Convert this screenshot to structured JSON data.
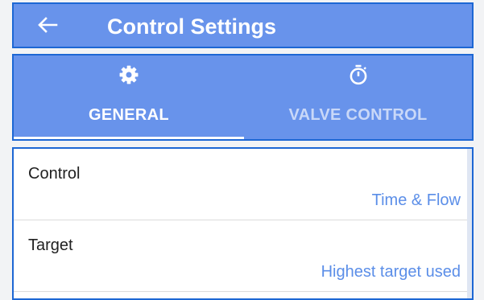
{
  "header": {
    "title": "Control Settings",
    "back_icon": "arrow-left-icon"
  },
  "tabs": [
    {
      "label": "GENERAL",
      "icon": "gear-icon",
      "selected": true
    },
    {
      "label": "VALVE CONTROL",
      "icon": "stopwatch-icon",
      "selected": false
    }
  ],
  "settings": [
    {
      "label": "Control",
      "value": "Time & Flow"
    },
    {
      "label": "Target",
      "value": "Highest target used"
    }
  ],
  "colors": {
    "primary": "#6893eb",
    "border": "#1d67d4",
    "accent_text": "#5b8ee8",
    "inactive_tab_text": "#c9d8f8",
    "background": "#f2f3f5"
  }
}
